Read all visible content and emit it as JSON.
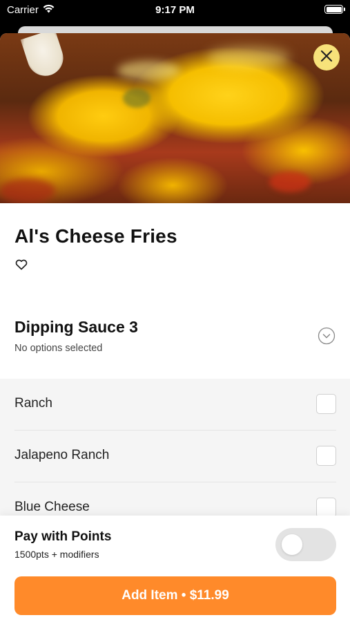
{
  "status_bar": {
    "carrier": "Carrier",
    "time": "9:17 PM",
    "icons": {
      "wifi": "wifi-icon",
      "battery": "battery-icon"
    }
  },
  "item": {
    "title": "Al's Cheese Fries",
    "favorite_icon": "heart-icon",
    "close_icon": "close-icon"
  },
  "section": {
    "title": "Dipping Sauce 3",
    "subtitle": "No options selected",
    "chevron_icon": "chevron-down-circle-icon",
    "options": [
      {
        "label": "Ranch",
        "selected": false
      },
      {
        "label": "Jalapeno Ranch",
        "selected": false
      },
      {
        "label": "Blue Cheese",
        "selected": false
      }
    ]
  },
  "points": {
    "title": "Pay with Points",
    "subtitle": "1500pts + modifiers",
    "enabled": false
  },
  "cta": {
    "label": "Add Item • $11.99"
  },
  "colors": {
    "accent": "#ff8a2a",
    "close_button_bg": "#f7e27a",
    "options_bg": "#f5f5f5",
    "toggle_off": "#e3e3e3"
  }
}
